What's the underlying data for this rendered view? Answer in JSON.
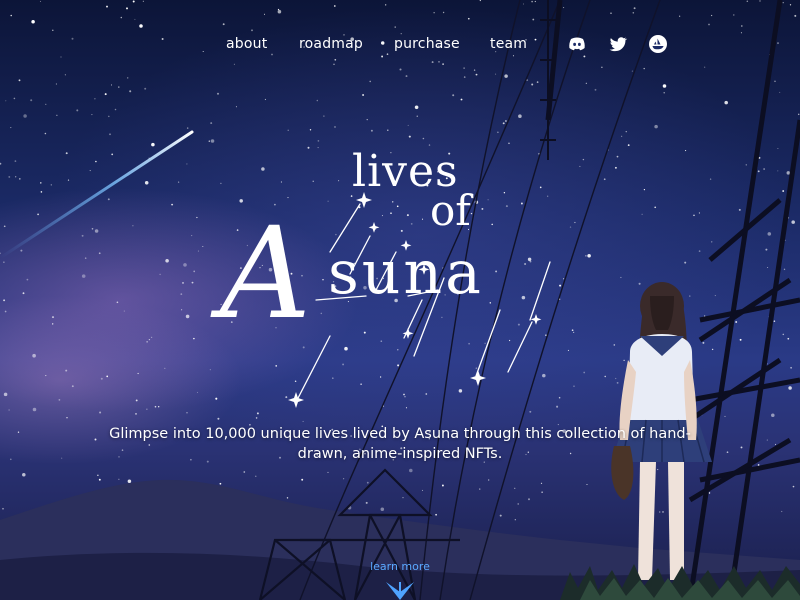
{
  "nav": {
    "links": [
      {
        "label": "about"
      },
      {
        "label": "roadmap"
      },
      {
        "label": "purchase"
      },
      {
        "label": "team"
      }
    ],
    "social": [
      {
        "icon": "discord-icon"
      },
      {
        "icon": "twitter-icon"
      },
      {
        "icon": "opensea-icon"
      }
    ]
  },
  "hero": {
    "title_lives": "lives",
    "title_of": "of",
    "title_a": "A",
    "title_suna": "suna",
    "tagline": "Glimpse into 10,000 unique lives lived by Asuna through this collection of hand-drawn, anime-inspired NFTs.",
    "learn_more": "learn more"
  },
  "colors": {
    "text": "#ffffff",
    "accent": "#5aa9ff",
    "sky_top": "#0c1538",
    "sky_mid": "#2a3a86"
  }
}
